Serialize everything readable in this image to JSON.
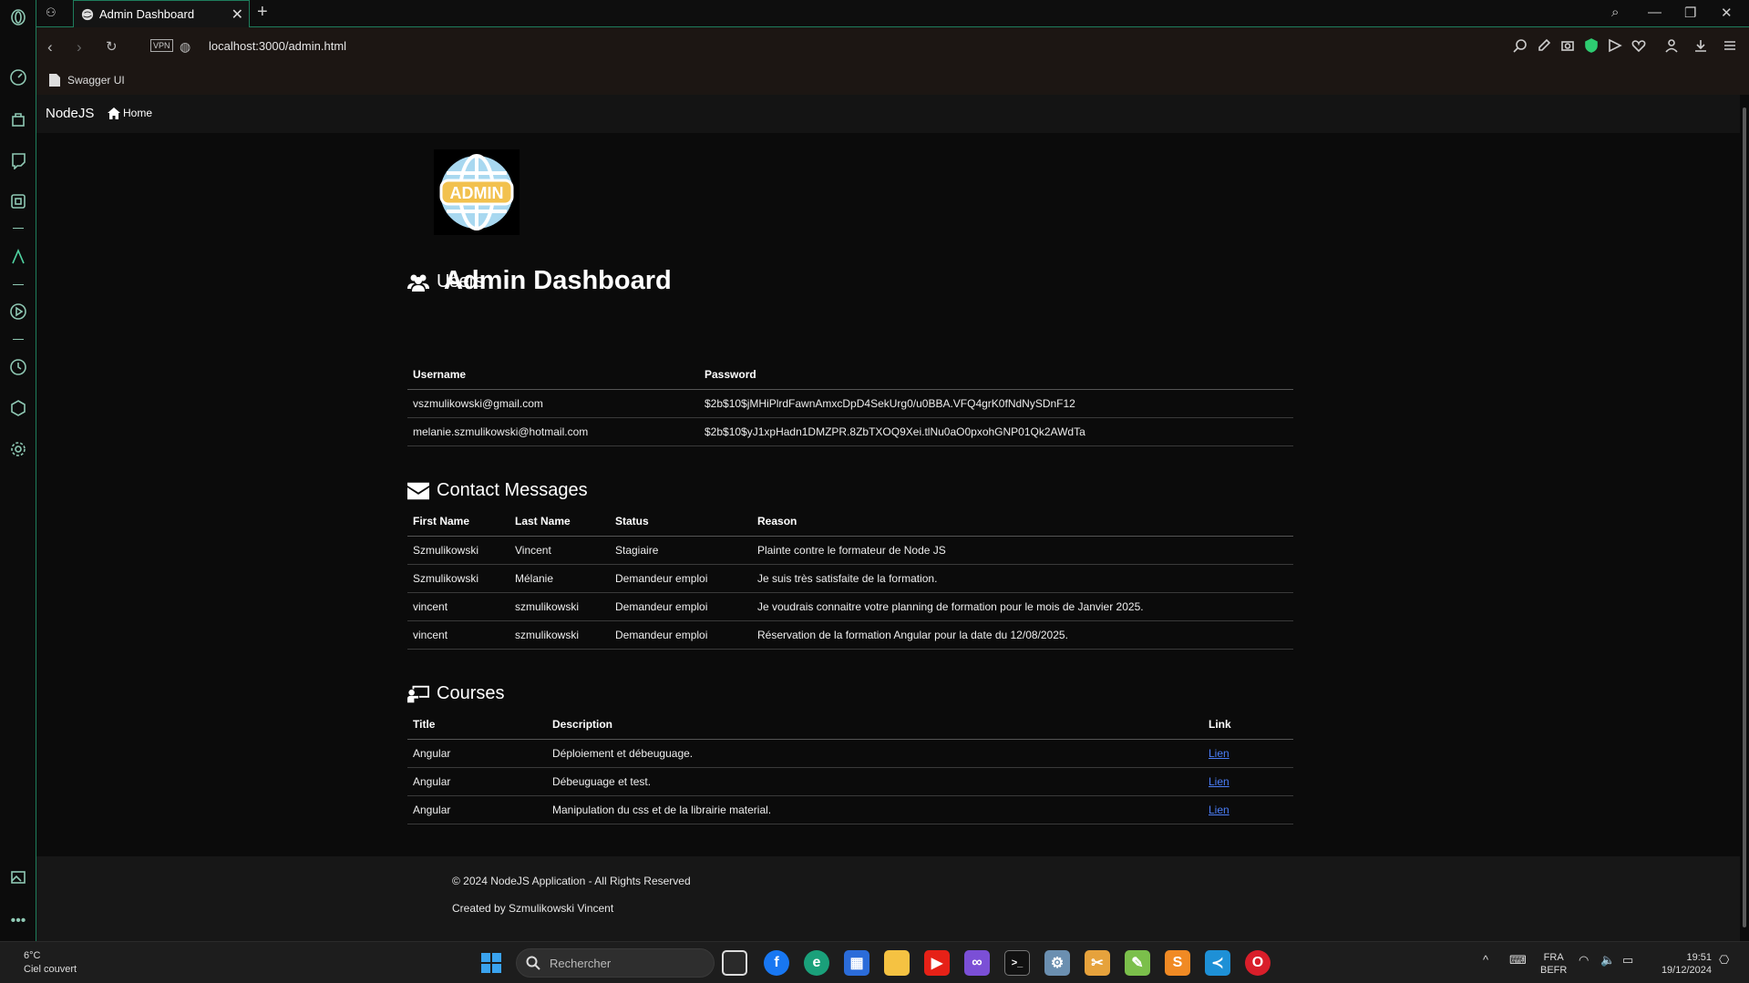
{
  "browser": {
    "tab_title": "Admin Dashboard",
    "url": "localhost:3000/admin.html",
    "vpn_label": "VPN",
    "bookmark": "Swagger UI"
  },
  "navbar": {
    "brand": "NodeJS",
    "home_label": "Home"
  },
  "logo": {
    "text": "ADMIN"
  },
  "page_title": "Admin Dashboard",
  "users": {
    "title": "Users",
    "headers": [
      "Username",
      "Password"
    ],
    "rows": [
      [
        "vszmulikowski@gmail.com",
        "$2b$10$jMHiPlrdFawnAmxcDpD4SekUrg0/u0BBA.VFQ4grK0fNdNySDnF12"
      ],
      [
        "melanie.szmulikowski@hotmail.com",
        "$2b$10$yJ1xpHadn1DMZPR.8ZbTXOQ9Xei.tlNu0aO0pxohGNP01Qk2AWdTa"
      ]
    ]
  },
  "contacts": {
    "title": "Contact Messages",
    "headers": [
      "First Name",
      "Last Name",
      "Status",
      "Reason"
    ],
    "rows": [
      [
        "Szmulikowski",
        "Vincent",
        "Stagiaire",
        "Plainte contre le formateur de Node JS"
      ],
      [
        "Szmulikowski",
        "Mélanie",
        "Demandeur emploi",
        "Je suis très satisfaite de la formation."
      ],
      [
        "vincent",
        "szmulikowski",
        "Demandeur emploi",
        "Je voudrais connaitre votre planning de formation pour le mois de Janvier 2025."
      ],
      [
        "vincent",
        "szmulikowski",
        "Demandeur emploi",
        "Réservation de la formation Angular pour la date du 12/08/2025."
      ]
    ]
  },
  "courses": {
    "title": "Courses",
    "headers": [
      "Title",
      "Description",
      "Link"
    ],
    "rows": [
      [
        "Angular",
        "Déploiement et débeuguage.",
        "Lien"
      ],
      [
        "Angular",
        "Débeuguage et test.",
        "Lien"
      ],
      [
        "Angular",
        "Manipulation du css et de la librairie material.",
        "Lien"
      ]
    ]
  },
  "footer": {
    "copyright": "© 2024 NodeJS Application - All Rights Reserved",
    "created_by": "Created by Szmulikowski Vincent"
  },
  "taskbar": {
    "weather_temp": "6°C",
    "weather_desc": "Ciel couvert",
    "search_placeholder": "Rechercher",
    "lang": "FRA",
    "layout": "BEFR",
    "time": "19:51",
    "date": "19/12/2024"
  },
  "colors": {
    "accent": "#1e7d5c",
    "link": "#4a7df7",
    "windows_blue": "#3aa3ef"
  }
}
